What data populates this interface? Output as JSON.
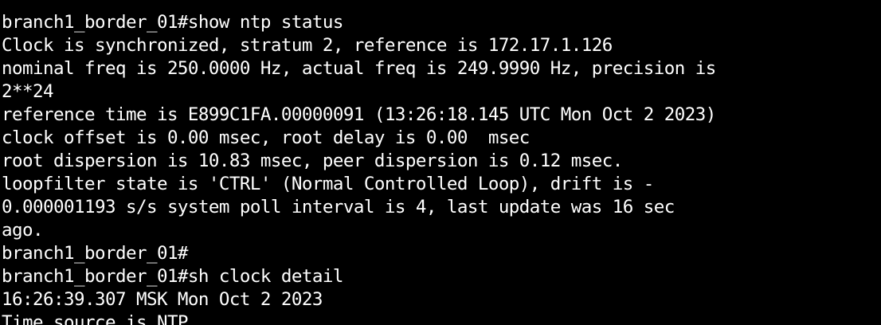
{
  "terminal": {
    "background": "#000000",
    "foreground": "#ffffff",
    "lines": [
      "",
      "branch1_border_01#show ntp status",
      "Clock is synchronized, stratum 2, reference is 172.17.1.126",
      "nominal freq is 250.0000 Hz, actual freq is 249.9990 Hz, precision is",
      "2**24",
      "reference time is E899C1FA.00000091 (13:26:18.145 UTC Mon Oct 2 2023)",
      "clock offset is 0.00 msec, root delay is 0.00  msec",
      "root dispersion is 10.83 msec, peer dispersion is 0.12 msec.",
      "loopfilter state is 'CTRL' (Normal Controlled Loop), drift is -",
      "0.000001193 s/s system poll interval is 4, last update was 16 sec",
      "ago.",
      "branch1_border_01#",
      "branch1_border_01#sh clock detail",
      "16:26:39.307 MSK Mon Oct 2 2023",
      "Time source is NTP"
    ]
  }
}
